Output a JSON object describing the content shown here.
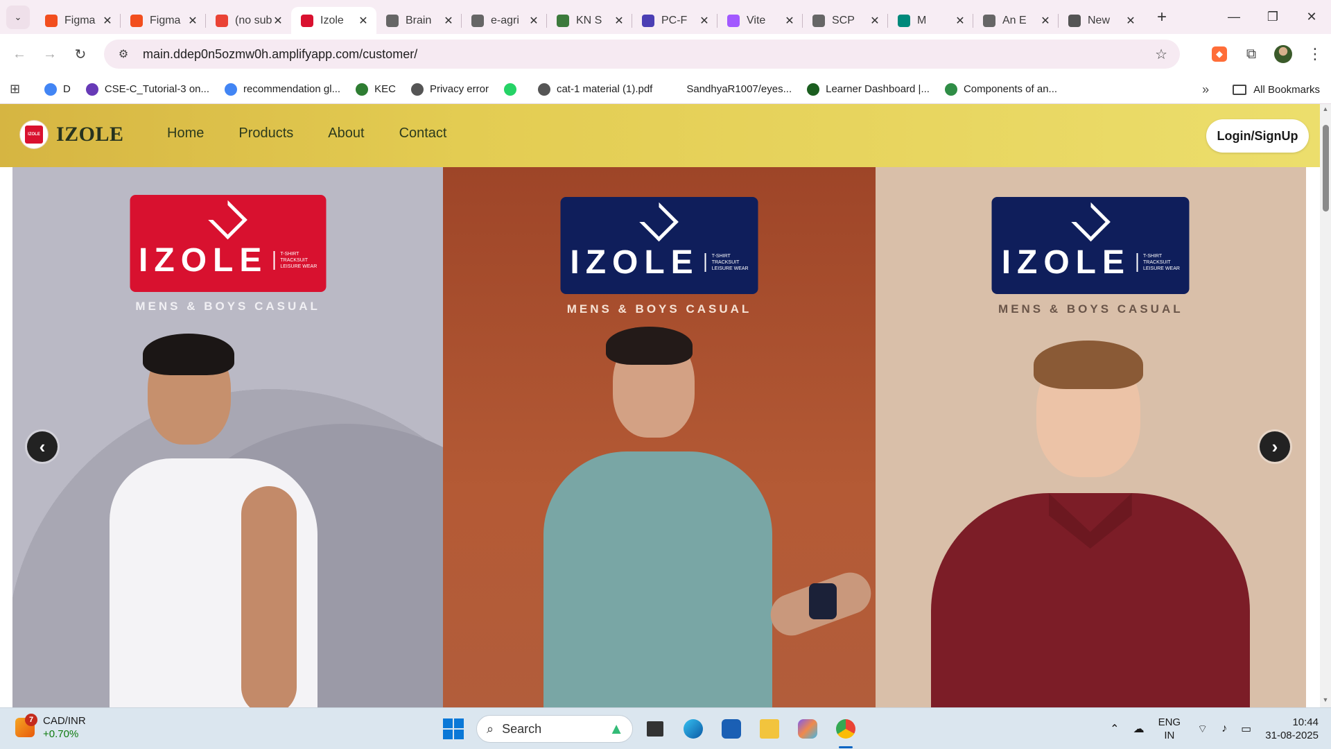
{
  "browser": {
    "tabs": [
      {
        "label": "Figma",
        "icon": "figma-icon",
        "color": "#f24e1e",
        "active": false
      },
      {
        "label": "Figma",
        "icon": "figma-icon",
        "color": "#f24e1e",
        "active": false
      },
      {
        "label": "(no subject)",
        "icon": "gmail-icon",
        "color": "#ea4335",
        "active": false
      },
      {
        "label": "Izole",
        "icon": "izole-favicon",
        "color": "#d9112f",
        "active": true
      },
      {
        "label": "Brain",
        "icon": "globe-icon",
        "color": "#666666",
        "active": false
      },
      {
        "label": "e-agri",
        "icon": "globe-icon",
        "color": "#666666",
        "active": false
      },
      {
        "label": "KN S",
        "icon": "kn-icon",
        "color": "#3c7a3c",
        "active": false
      },
      {
        "label": "PC-F",
        "icon": "pc-icon",
        "color": "#4b3fb4",
        "active": false
      },
      {
        "label": "Vite",
        "icon": "vite-icon",
        "color": "#a259ff",
        "active": false
      },
      {
        "label": "SCP",
        "icon": "globe-icon",
        "color": "#666666",
        "active": false
      },
      {
        "label": "M",
        "icon": "meet-icon",
        "color": "#00897b",
        "active": false
      },
      {
        "label": "An E",
        "icon": "globe-icon",
        "color": "#666666",
        "active": false
      },
      {
        "label": "New",
        "icon": "chrome-icon",
        "color": "#555555",
        "active": false
      }
    ],
    "url": "main.ddep0n5ozmw0h.amplifyapp.com/customer/",
    "bookmarks": [
      {
        "label": "D",
        "icon": "google-icon",
        "color": "#4285f4"
      },
      {
        "label": "CSE-C_Tutorial-3 on...",
        "icon": "forms-icon",
        "color": "#673ab7"
      },
      {
        "label": "recommendation gl...",
        "icon": "google-icon",
        "color": "#4285f4"
      },
      {
        "label": "KEC",
        "icon": "kec-icon",
        "color": "#2e7d32"
      },
      {
        "label": "Privacy error",
        "icon": "globe-icon",
        "color": "#555555"
      },
      {
        "label": "",
        "icon": "whatsapp-icon",
        "color": "#25d366"
      },
      {
        "label": "cat-1 material (1).pdf",
        "icon": "globe-icon",
        "color": "#555555"
      },
      {
        "label": "SandhyaR1007/eyes...",
        "icon": "github-icon",
        "color": "#ffffff"
      },
      {
        "label": "Learner Dashboard |...",
        "icon": "leaf-icon",
        "color": "#1b5e20"
      },
      {
        "label": "Components of an...",
        "icon": "gfg-icon",
        "color": "#2f8d46"
      }
    ],
    "all_bookmarks": "All Bookmarks"
  },
  "site": {
    "brand": "IZOLE",
    "nav": [
      "Home",
      "Products",
      "About",
      "Contact"
    ],
    "login": "Login/SignUp",
    "colors": {
      "navbar_start": "#d6b542",
      "navbar_end": "#ecde6c",
      "text_dark": "#26331f"
    }
  },
  "carousel": {
    "slides": [
      {
        "logo_text": "IZOLE",
        "logo_sub": "T-SHIRT\nTRACKSUIT\nLEISURE WEAR",
        "tagline": "MENS & BOYS CASUAL",
        "logo_color": "#d8112f"
      },
      {
        "logo_text": "IZOLE",
        "logo_sub": "T-SHIRT\nTRACKSUIT\nLEISURE WEAR",
        "tagline": "MENS & BOYS CASUAL",
        "logo_color": "#0f1e5b"
      },
      {
        "logo_text": "IZOLE",
        "logo_sub": "T-SHIRT\nTRACKSUIT\nLEISURE WEAR",
        "tagline": "MENS & BOYS CASUAL",
        "logo_color": "#0f1e5b"
      }
    ],
    "prev": "‹",
    "next": "›"
  },
  "taskbar": {
    "widget_title": "CAD/INR",
    "widget_change": "+0.70%",
    "widget_badge": "7",
    "search_placeholder": "Search",
    "lang_top": "ENG",
    "lang_bottom": "IN",
    "time": "10:44",
    "date": "31-08-2025"
  }
}
